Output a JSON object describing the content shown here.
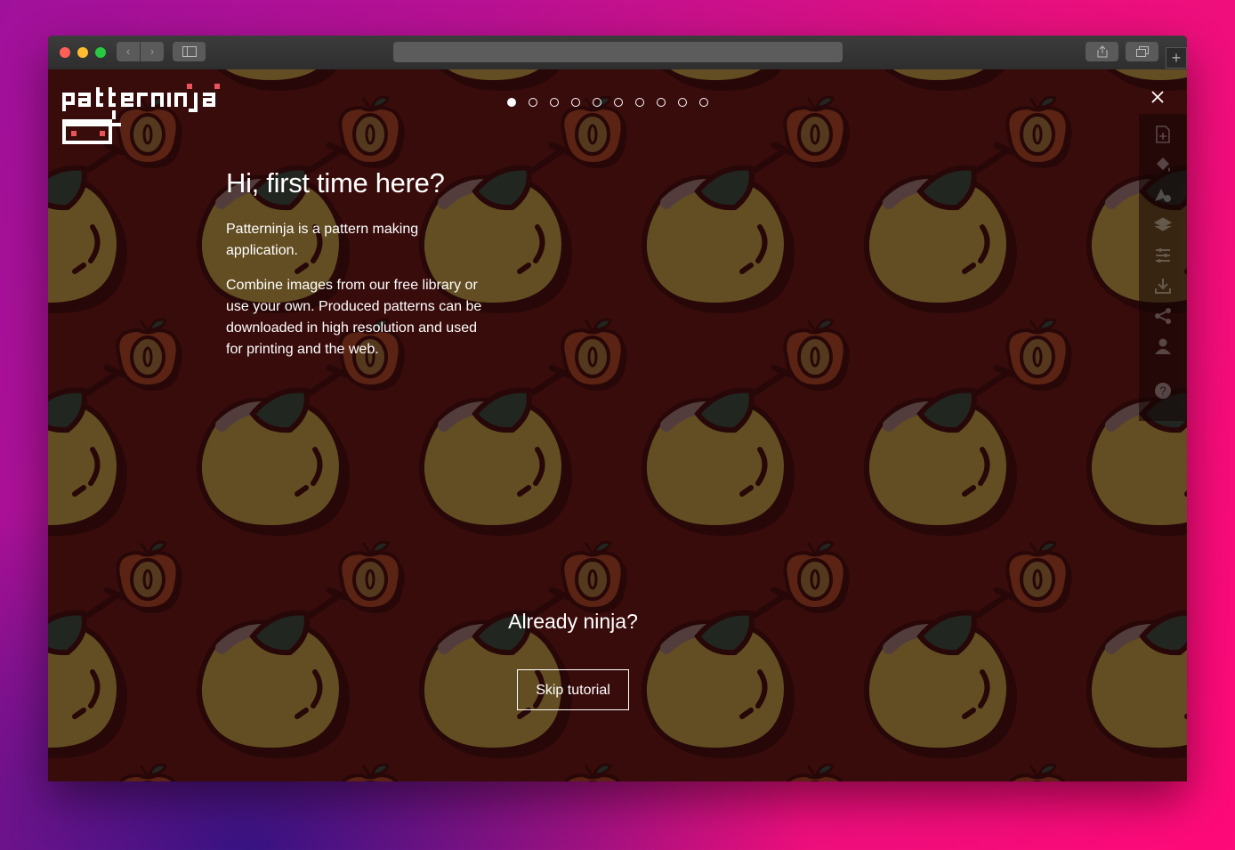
{
  "browser": {
    "back_label": "‹",
    "forward_label": "›",
    "new_tab_label": "+",
    "traffic_lights": [
      "#ff5f57",
      "#febc2e",
      "#28c840"
    ]
  },
  "app": {
    "logo_text": "patternninja",
    "slides_total": 10,
    "active_slide": 1,
    "colors": {
      "background": "#3b0e0e",
      "pear": "#8a8a3a",
      "leaf": "#0f3f36",
      "outline": "#1b0606"
    }
  },
  "tutorial": {
    "heading": "Hi, first time here?",
    "paragraph1": "Patterninja is a pattern making application.",
    "paragraph2": "Combine images from our free library or use your own. Produced patterns can be downloaded in high resolution and used for printing and the web.",
    "already_title": "Already ninja?",
    "skip_label": "Skip tutorial"
  },
  "side_tools": [
    "new-file-icon",
    "fill-icon",
    "shapes-icon",
    "layers-icon",
    "sliders-icon",
    "download-icon",
    "share-icon",
    "user-icon",
    "help-icon"
  ]
}
